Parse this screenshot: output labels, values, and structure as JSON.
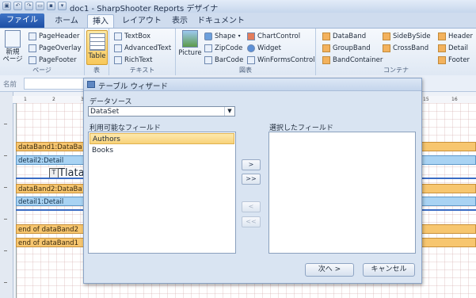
{
  "window": {
    "title": "doc1 - SharpShooter Reports デザイナ"
  },
  "tabs": {
    "file": "ファイル",
    "items": [
      "ホーム",
      "挿入",
      "レイアウト",
      "表示",
      "ドキュメント"
    ],
    "active": "挿入"
  },
  "ribbon": {
    "page_group": {
      "label": "ページ",
      "new_page": "新規\nページ",
      "items": [
        "PageHeader",
        "PageOverlay",
        "PageFooter"
      ]
    },
    "table_group": {
      "label": "表",
      "table": "Table"
    },
    "text_group": {
      "label": "テキスト",
      "items": [
        "TextBox",
        "AdvancedText",
        "RichText"
      ]
    },
    "chart_group": {
      "label": "図表",
      "picture": "Picture",
      "items": [
        "Shape",
        "ZipCode",
        "BarCode",
        "ChartControl",
        "Widget",
        "WinFormsControl"
      ]
    },
    "container_group": {
      "label": "コンテナ",
      "items": [
        "DataBand",
        "GroupBand",
        "BandContainer",
        "SideBySide",
        "CrossBand",
        "Header",
        "Detail",
        "Footer"
      ]
    }
  },
  "namebar": {
    "label": "名前"
  },
  "ruler": {
    "ticks": [
      "1",
      "2",
      "3",
      "4",
      "5",
      "6",
      "7",
      "8",
      "9",
      "10",
      "11",
      "12",
      "13",
      "14",
      "15",
      "16"
    ]
  },
  "designer": {
    "bands": [
      "dataBand1:DataBa",
      "detail2:Detail",
      "Tlata",
      "dataBand2:DataBa",
      "detail1:Detail",
      "end of dataBand2",
      "end of dataBand1"
    ]
  },
  "dialog": {
    "title": "テーブル ウィザード",
    "datasource_label": "データソース",
    "datasource_value": "DataSet",
    "available_label": "利用可能なフィールド",
    "selected_label": "選択したフィールド",
    "available_fields": [
      "Authors",
      "Books"
    ],
    "selected_field_index": 0,
    "move_buttons": [
      ">",
      ">>",
      "<",
      "<<"
    ],
    "next": "次へ >",
    "cancel": "キャンセル"
  },
  "colors": {
    "band_orange": "#f7c66f",
    "band_blue": "#a9d3f3",
    "selection": "#f8d27a",
    "file_tab": "#1d4fa5"
  }
}
